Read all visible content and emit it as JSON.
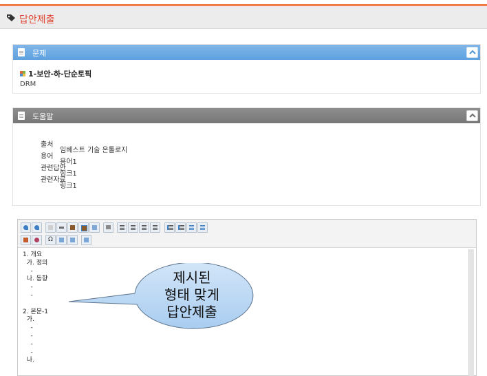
{
  "header": {
    "title": "답안제출",
    "accent_color": "#f07c4a",
    "title_color": "#e0442e"
  },
  "problem_panel": {
    "title": "문제",
    "problem_title": "1-보안-하-단순토픽",
    "problem_subtitle": "DRM"
  },
  "help_panel": {
    "title": "도움말",
    "labels": [
      "출처",
      "용어",
      "관련답안",
      "관련자료"
    ],
    "source_value": "임베스트 기술 온톨로지",
    "term_value": "용어1",
    "answer_value": "링크1",
    "material_value": "링크1"
  },
  "editor": {
    "toolbar_icons": [
      "undo-icon",
      "redo-icon",
      "copy-icon",
      "cut-icon",
      "paste-text-icon",
      "paste-word-icon",
      "select-all-icon",
      "spell-check-icon",
      "align-left-icon",
      "align-center-icon",
      "align-right-icon",
      "align-justify-icon",
      "ordered-list-icon",
      "unordered-list-icon",
      "outdent-icon",
      "indent-icon",
      "format-icon",
      "remove-format-icon",
      "special-char-icon",
      "table-icon",
      "image-icon",
      "box-icon"
    ],
    "special_char_label": "Ω",
    "lines": [
      "1. 개요",
      "  가. 정의",
      "    -",
      "  나. 동향",
      "    -",
      "    -",
      "",
      "2. 본문-1",
      "  가.",
      "    -",
      "    -",
      "    -",
      "    -",
      "  나."
    ]
  },
  "callout": {
    "lines": [
      "제시된",
      "형태 맞게",
      "답안제출"
    ],
    "fill_color": "#bcd7f3"
  }
}
